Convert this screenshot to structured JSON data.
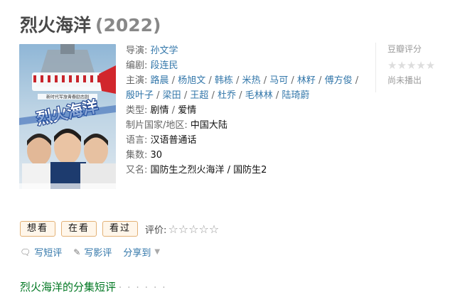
{
  "title": "烈火海洋",
  "year": "(2022)",
  "info": {
    "director_label": "导演:",
    "director": "孙文学",
    "writer_label": "编剧:",
    "writer": "段连民",
    "cast_label": "主演:",
    "cast": [
      "路晨",
      "杨旭文",
      "韩栋",
      "米热",
      "马可",
      "林籽",
      "傅方俊",
      "殷叶子",
      "梁田",
      "王超",
      "杜乔",
      "毛林林",
      "陆琦蔚"
    ],
    "genre_label": "类型:",
    "genres": [
      "剧情",
      "爱情"
    ],
    "country_label": "制片国家/地区:",
    "country": "中国大陆",
    "language_label": "语言:",
    "language": "汉语普通话",
    "episodes_label": "集数:",
    "episodes": "30",
    "aka_label": "又名:",
    "aka": "国防生之烈火海洋 / 国防生2"
  },
  "rating": {
    "label": "豆瓣评分",
    "stars": "★★★★★",
    "status": "尚未播出"
  },
  "poster": {
    "title_text": "烈火海洋",
    "banner_text": "新时代军旅青春励志剧"
  },
  "actions": {
    "want": "想看",
    "watching": "在看",
    "watched": "看过",
    "rate_label": "评价:",
    "rate_stars": "☆☆☆☆☆"
  },
  "writes": {
    "short_review": "写短评",
    "review": "写影评",
    "share": "分享到"
  },
  "section": {
    "title": "烈火海洋的分集短评",
    "dots": "· · · · · ·"
  }
}
